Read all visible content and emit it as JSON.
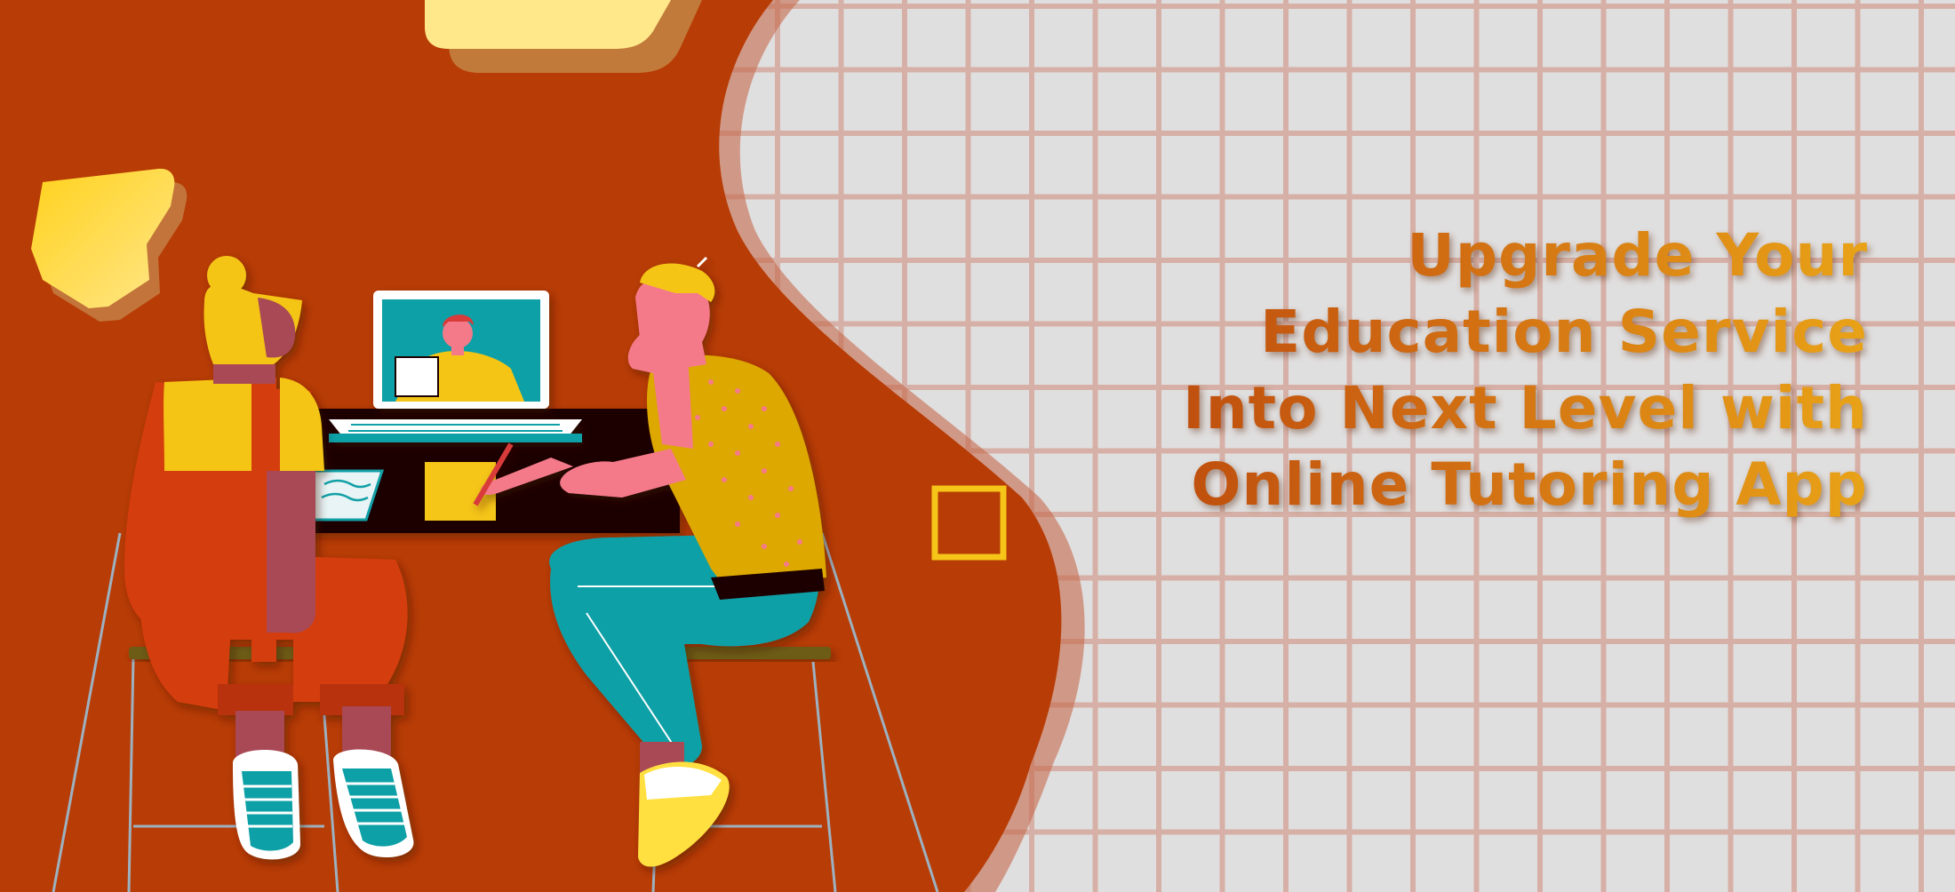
{
  "banner": {
    "headline_lines": [
      "Upgrade Your",
      "Education Service",
      "Into Next Level with",
      "Online Tutoring App"
    ]
  },
  "colors": {
    "background_grid": "#e0dfdf",
    "grid_lines": "#d6b0a6",
    "blob": "#b83c05",
    "accent_yellow": "#f5c518",
    "teal": "#11a0a6",
    "headline_start": "#b8430c",
    "headline_end": "#e9a317"
  },
  "illustration": {
    "subject": "two people at a desk with a laptop showing a video-call tutor",
    "icons": [
      "laptop-icon",
      "tutor-video-call",
      "student-left",
      "student-right",
      "stool-icon",
      "square-outline-icon",
      "blob-shape"
    ]
  }
}
